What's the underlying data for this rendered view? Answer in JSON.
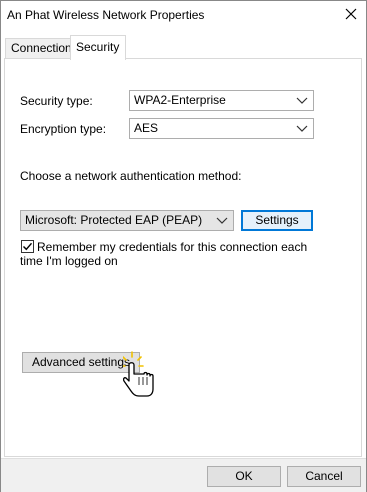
{
  "window": {
    "title": "An Phat Wireless Network Properties"
  },
  "tabs": [
    {
      "label": "Connection",
      "active": false
    },
    {
      "label": "Security",
      "active": true
    }
  ],
  "security": {
    "security_type_label": "Security type:",
    "security_type_value": "WPA2-Enterprise",
    "encryption_type_label": "Encryption type:",
    "encryption_type_value": "AES",
    "auth_method_label": "Choose a network authentication method:",
    "auth_method_value": "Microsoft: Protected EAP (PEAP)",
    "settings_button": "Settings",
    "remember_checked": true,
    "remember_label_line1": "Remember my credentials for this connection each",
    "remember_label_line2": "time I'm logged on",
    "advanced_button": "Advanced settings"
  },
  "footer": {
    "ok_label": "OK",
    "cancel_label": "Cancel"
  },
  "colors": {
    "focus_blue": "#0078d7",
    "button_gray": "#e1e1e1",
    "cursor_glow": "#f2c200"
  },
  "icons": {
    "close": "close-icon",
    "dropdown": "chevron-down-icon",
    "cursor": "hand-pointer-icon"
  }
}
